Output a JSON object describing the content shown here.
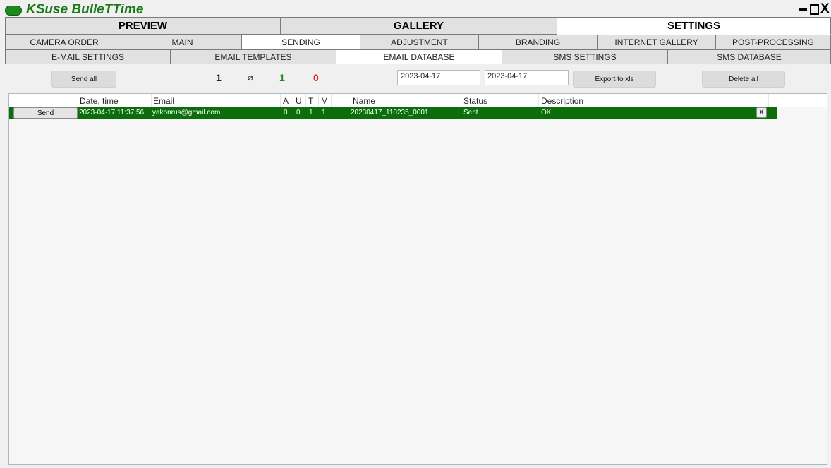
{
  "app": {
    "title": "KSuse BulleTTime",
    "close_glyph": "X"
  },
  "main_tabs": [
    {
      "label": "PREVIEW",
      "active": false
    },
    {
      "label": "GALLERY",
      "active": false
    },
    {
      "label": "SETTINGS",
      "active": true
    }
  ],
  "settings_tabs": [
    {
      "label": "CAMERA ORDER",
      "active": false
    },
    {
      "label": "MAIN",
      "active": false
    },
    {
      "label": "SENDING",
      "active": true
    },
    {
      "label": "ADJUSTMENT",
      "active": false
    },
    {
      "label": "BRANDING",
      "active": false
    },
    {
      "label": "INTERNET GALLERY",
      "active": false
    },
    {
      "label": "POST-PROCESSING",
      "active": false
    }
  ],
  "sending_tabs": [
    {
      "label": "E-MAIL SETTINGS",
      "active": false
    },
    {
      "label": "EMAIL TEMPLATES",
      "active": false
    },
    {
      "label": "EMAIL DATABASE",
      "active": true
    },
    {
      "label": "SMS SETTINGS",
      "active": false
    },
    {
      "label": "SMS DATABASE",
      "active": false
    }
  ],
  "toolbar": {
    "send_all": "Send all",
    "count_total": "1",
    "attach_icon": "paperclip-icon",
    "attach_glyph": "⌀",
    "count_sent": "1",
    "count_failed": "0",
    "date_from": "2023-04-17",
    "date_to": "2023-04-17",
    "export_label": "Export to xls",
    "delete_all": "Delete all",
    "colors": {
      "sent": "#1a8a1a",
      "failed": "#e02020"
    }
  },
  "table": {
    "columns": [
      "Date, time",
      "Email",
      "A",
      "U",
      "T",
      "M",
      "Name",
      "Status",
      "Description"
    ],
    "rows": [
      {
        "send_label": "Send",
        "datetime": "2023-04-17 11:37:56",
        "email": "yakonrus@gmail.com",
        "a": "0",
        "u": "0",
        "t": "1",
        "m": "1",
        "name": "20230417_110235_0001",
        "status": "Sent",
        "description": "OK",
        "delete_label": "X"
      }
    ],
    "row_color": "#0b6e0b"
  }
}
